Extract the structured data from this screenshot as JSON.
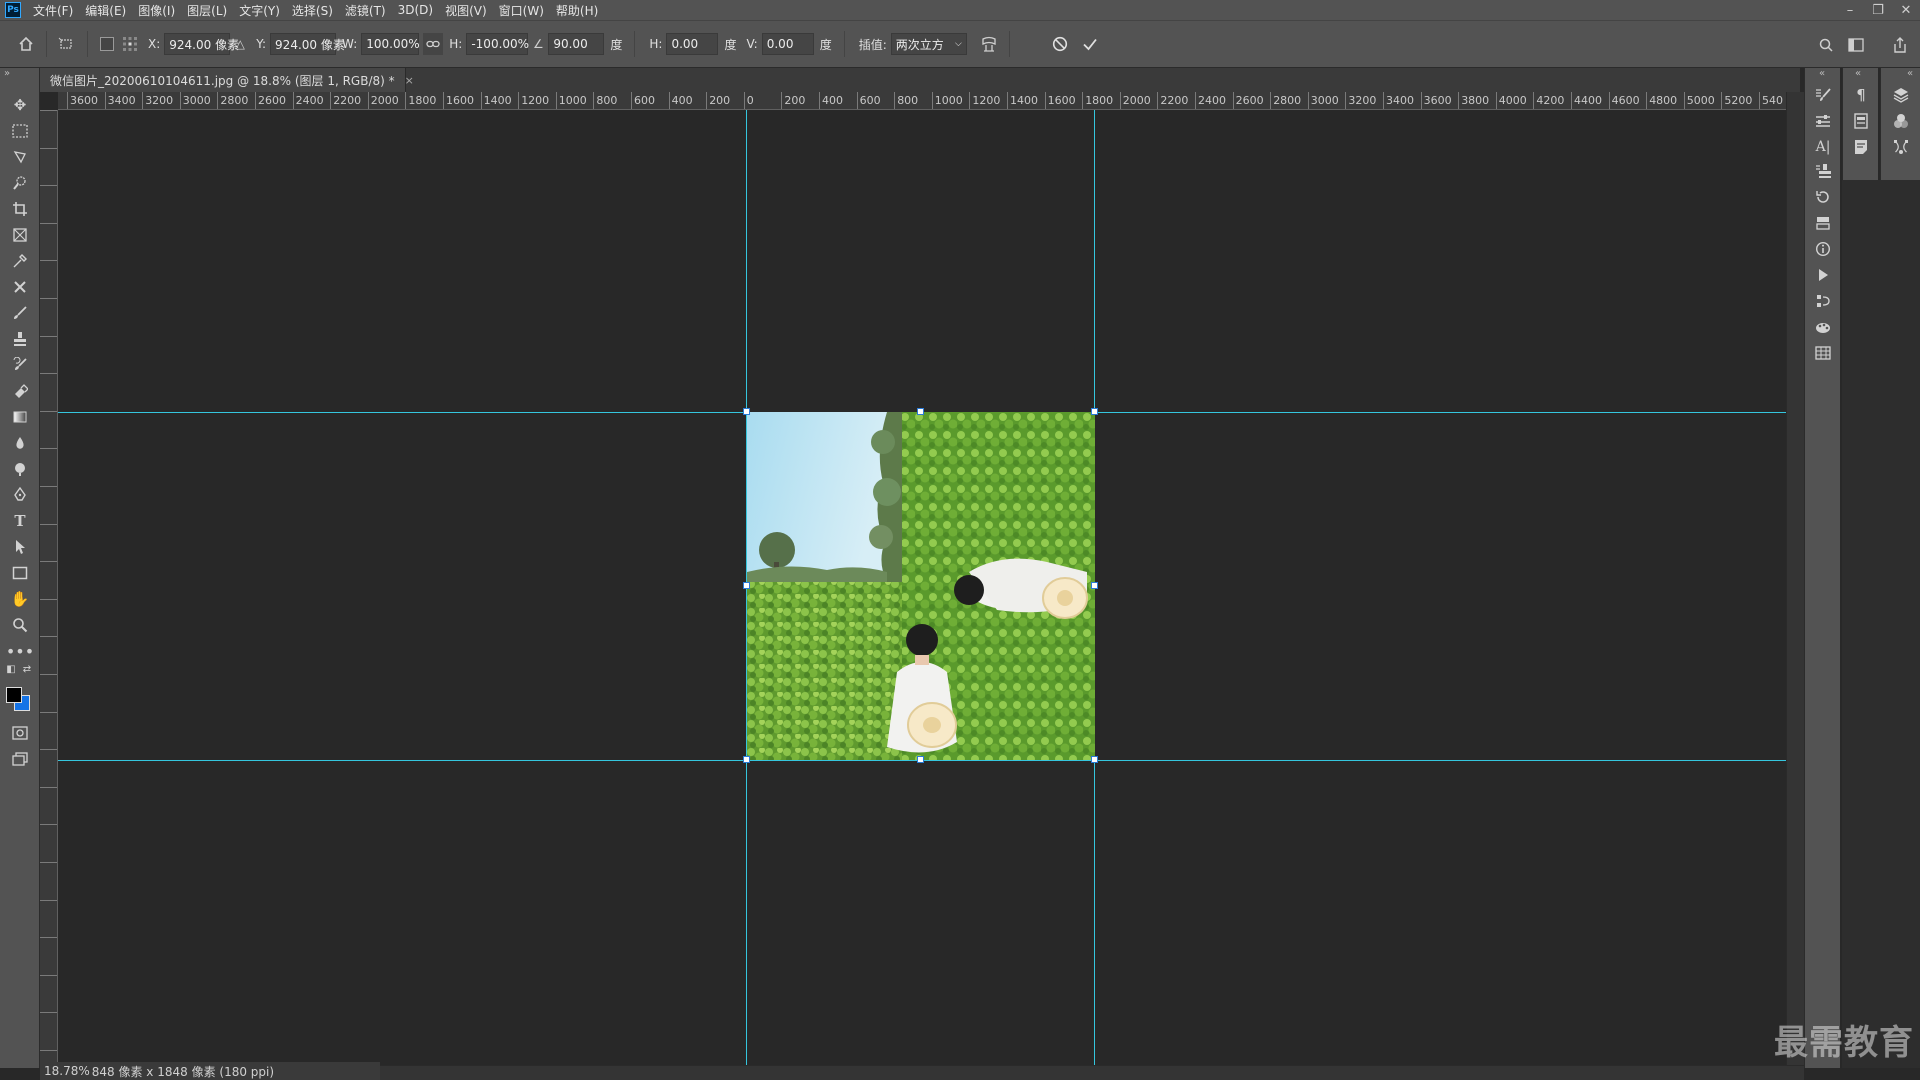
{
  "app": {
    "logo": "Ps"
  },
  "menu": [
    "文件(F)",
    "编辑(E)",
    "图像(I)",
    "图层(L)",
    "文字(Y)",
    "选择(S)",
    "滤镜(T)",
    "3D(D)",
    "视图(V)",
    "窗口(W)",
    "帮助(H)"
  ],
  "window_controls": {
    "minimize": "–",
    "restore": "❐",
    "close": "✕"
  },
  "options": {
    "x_label": "X:",
    "x_value": "924.00 像素",
    "y_label": "Y:",
    "y_value": "924.00 像素",
    "w_label": "W:",
    "w_value": "100.00%",
    "h_label": "H:",
    "h_value": "-100.00%",
    "angle_value": "90.00",
    "angle_unit": "度",
    "skew_h_label": "H:",
    "skew_h_value": "0.00",
    "skew_h_unit": "度",
    "skew_v_label": "V:",
    "skew_v_value": "0.00",
    "skew_v_unit": "度",
    "interp_label": "插值:",
    "interp_value": "两次立方"
  },
  "document": {
    "tab_title": "微信图片_20200610104611.jpg @ 18.8% (图层 1, RGB/8) *",
    "close": "×"
  },
  "ruler": {
    "h_labels": [
      "3600",
      "3400",
      "3200",
      "3000",
      "2800",
      "2600",
      "2400",
      "2200",
      "2000",
      "1800",
      "1600",
      "1400",
      "1200",
      "1000",
      "800",
      "600",
      "400",
      "200",
      "0",
      "200",
      "400",
      "600",
      "800",
      "1000",
      "1200",
      "1400",
      "1600",
      "1800",
      "2000",
      "2200",
      "2400",
      "2600",
      "2800",
      "3000",
      "3200",
      "3400",
      "3600",
      "3800",
      "4000",
      "4200",
      "4400",
      "4600",
      "4800",
      "5000",
      "5200",
      "540"
    ]
  },
  "status": {
    "zoom": "18.78%",
    "info": "848 像素 x 1848 像素 (180 ppi)"
  },
  "watermark": "最需教育",
  "colors": {
    "guide": "#35c6de",
    "foreground": "#000000",
    "background": "#1473e6"
  }
}
